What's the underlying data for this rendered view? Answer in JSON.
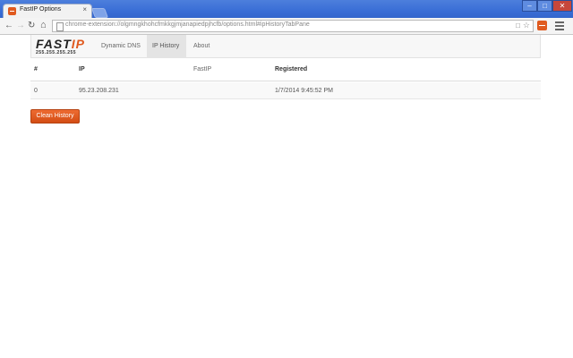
{
  "browser": {
    "tab_title": "FastIP Options",
    "tab_close": "×",
    "url": "chrome-extension://olgmngkhohcfmkkgjmjanapiedpjhcfb/options.html#ipHistoryTabPane",
    "window_controls": {
      "minimize": "–",
      "maximize": "□",
      "close": "✕"
    }
  },
  "brand": {
    "logo_main": "FAST",
    "logo_accent": "IP",
    "logo_sub": "255.255.255.255"
  },
  "nav": {
    "items": [
      {
        "label": "Dynamic DNS",
        "active": false
      },
      {
        "label": "IP History",
        "active": true
      },
      {
        "label": "About FastIP",
        "active": false
      }
    ]
  },
  "table": {
    "headers": [
      "#",
      "IP",
      "Registered"
    ],
    "rows": [
      [
        "0",
        "95.23.208.231",
        "1/7/2014 9:45:52 PM"
      ]
    ]
  },
  "actions": {
    "clean_history_label": "Clean History"
  },
  "colors": {
    "accent": "#e05a1f",
    "titlebar": "#3a6ed6"
  }
}
